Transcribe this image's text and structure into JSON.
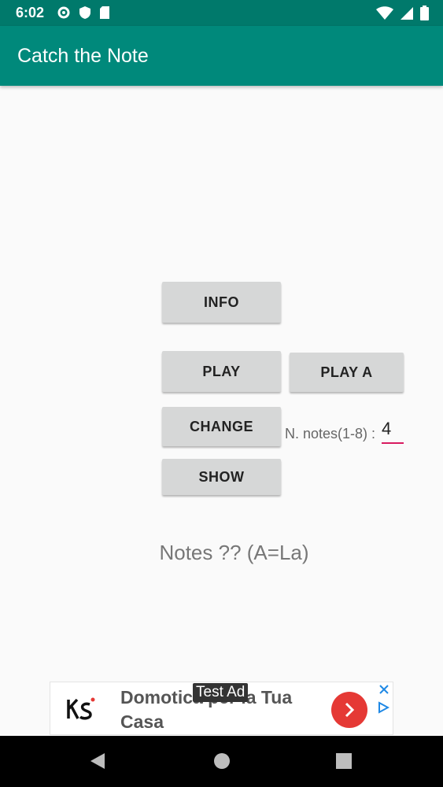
{
  "status_bar": {
    "time": "6:02",
    "icons": [
      "gear-icon",
      "shield-icon",
      "sd-card-icon",
      "wifi-icon",
      "signal-icon",
      "battery-icon"
    ]
  },
  "app_bar": {
    "title": "Catch the Note"
  },
  "buttons": {
    "info": "INFO",
    "play": "PLAY",
    "play_a": "PLAY A",
    "change": "CHANGE",
    "show": "SHOW"
  },
  "notes_count": {
    "label": "N. notes(1-8) :",
    "value": "4"
  },
  "result_text": "Notes ?? (A=La)",
  "ad": {
    "headline": "Domotica per la Tua Casa",
    "badge": "Test Ad"
  },
  "colors": {
    "status_bar": "#00796b",
    "app_bar": "#00897b",
    "button": "#d6d7d7",
    "input_underline": "#d81b60",
    "ad_cta": "#e53935"
  }
}
